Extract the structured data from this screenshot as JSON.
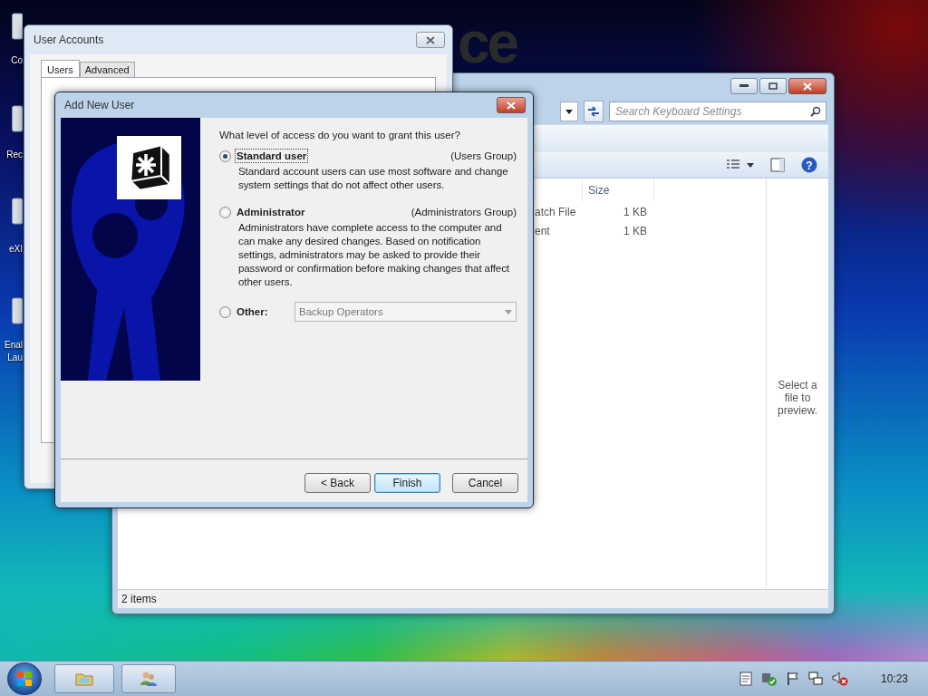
{
  "desktop": {
    "wallpaper_text": "ce",
    "icons": [
      {
        "label": "Co"
      },
      {
        "label": "Rec"
      },
      {
        "label": "eXI"
      },
      {
        "label": "Enal Lau"
      }
    ]
  },
  "explorer": {
    "search": {
      "placeholder": "Search Keyboard Settings"
    },
    "columns": [
      "Size"
    ],
    "rows": [
      {
        "type": "atch File",
        "size": "1 KB"
      },
      {
        "type": "ent",
        "size": "1 KB"
      }
    ],
    "help_label": "?",
    "preview_text": "Select a file to preview.",
    "status_bar": "2 items"
  },
  "user_accounts": {
    "title": "User Accounts",
    "tabs": [
      {
        "label": "Users",
        "selected": true
      },
      {
        "label": "Advanced",
        "selected": false
      }
    ]
  },
  "dialog": {
    "title": "Add New User",
    "question": "What level of access do you want to grant this user?",
    "options": [
      {
        "kind": "described",
        "label": "Standard user",
        "group": "(Users Group)",
        "description": "Standard account users can use most software and change system settings that do not affect other users.",
        "selected": true
      },
      {
        "kind": "described",
        "label": "Administrator",
        "group": "(Administrators Group)",
        "description": "Administrators have complete access to the computer and can make any desired changes. Based on notification settings, administrators may be asked to provide their password or confirmation before making changes that affect other users.",
        "selected": false
      },
      {
        "kind": "dropdown",
        "label": "Other:",
        "dropdown": {
          "value": "Backup Operators",
          "disabled": true
        },
        "selected": false
      }
    ],
    "buttons": [
      {
        "label": "< Back",
        "default": false
      },
      {
        "label": "Finish",
        "default": true
      },
      {
        "label": "Cancel",
        "default": false
      }
    ]
  },
  "taskbar": {
    "clock": "10:23"
  }
}
